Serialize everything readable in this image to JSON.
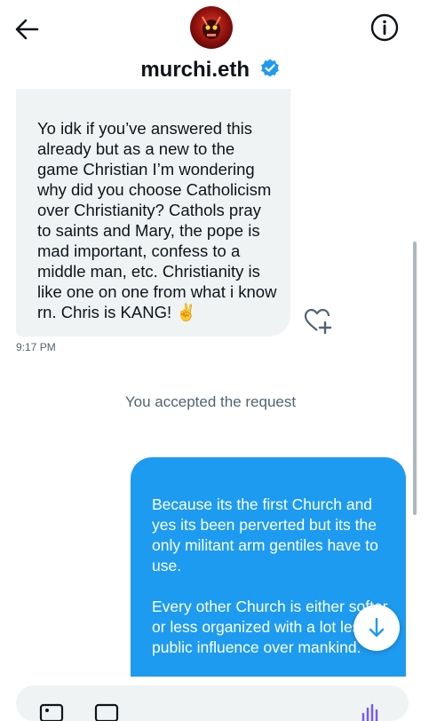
{
  "header": {
    "contact_name": "murchi.eth",
    "verified": true
  },
  "messages": {
    "incoming": {
      "text": "Yo idk if you’ve answered this already but as a new to the game Christian I’m wondering why did you choose Catholicism over Christianity? Cathols pray to saints and Mary, the pope is mad important, confess to a middle man, etc. Christianity is like one on one from what i know rn. Chris is KANG! ✌",
      "time": "9:17 PM"
    },
    "system": "You accepted the request",
    "outgoing": {
      "text": "Because its the first Church and yes its been perverted but its the only militant arm gentiles have to use.\n\nEvery other Church is either softer or less organized with a lot less public influence over mankind."
    }
  },
  "colors": {
    "accent": "#1d9bf0",
    "incoming_bubble": "#eff3f4",
    "secondary_text": "#536471"
  },
  "icons": [
    "back-arrow-icon",
    "info-icon",
    "verified-badge-icon",
    "add-reaction-icon",
    "arrow-down-icon",
    "image-icon",
    "gif-icon",
    "voice-icon"
  ]
}
